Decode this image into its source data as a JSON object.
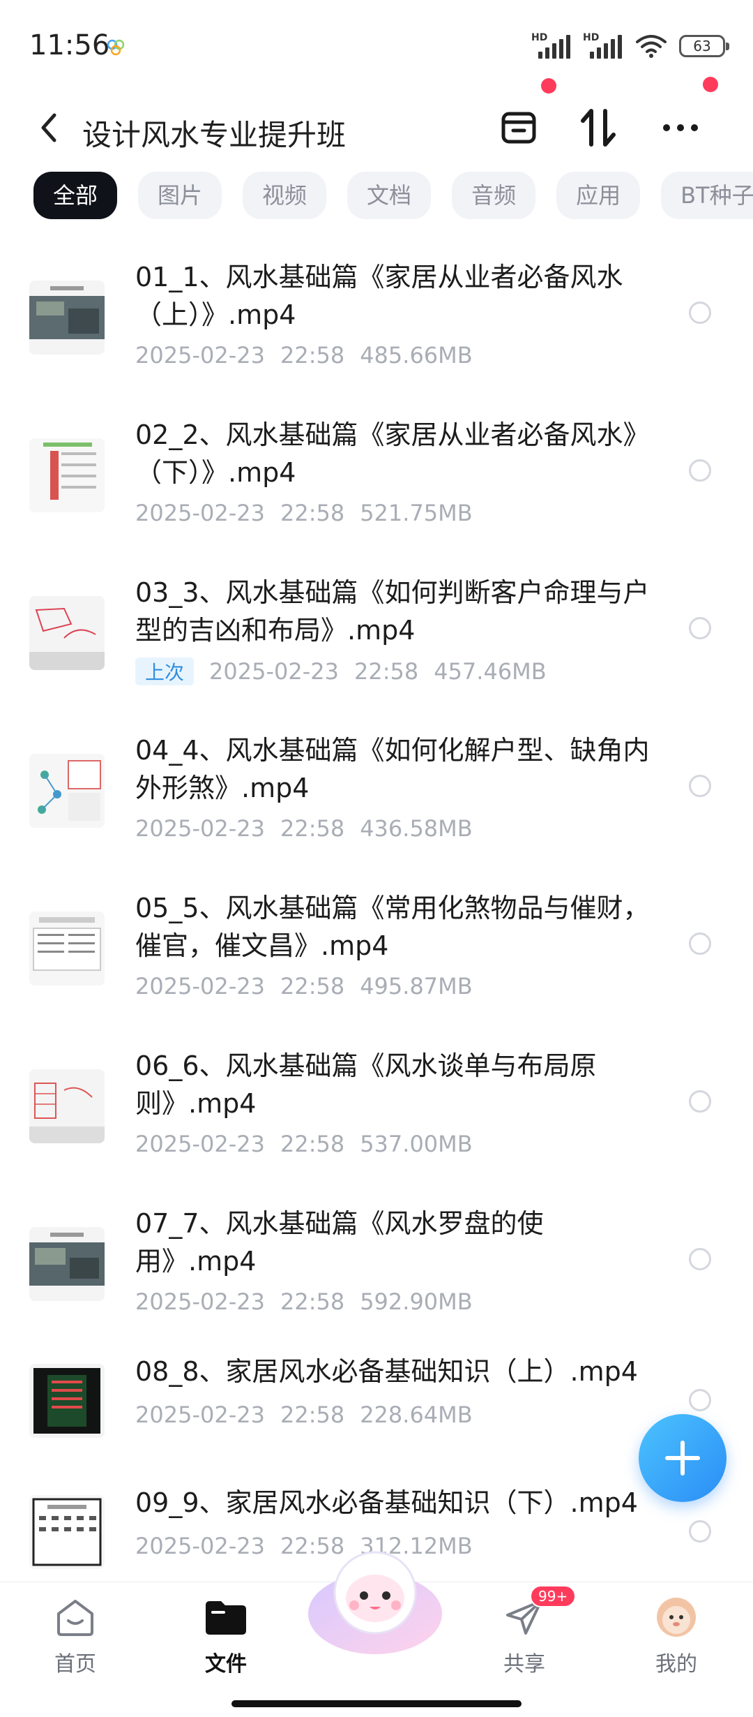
{
  "status": {
    "time": "11:56",
    "battery": "63",
    "hd_label": "HD"
  },
  "header": {
    "title": "设计风水专业提升班"
  },
  "tabs": [
    "全部",
    "图片",
    "视频",
    "文档",
    "音频",
    "应用",
    "BT种子"
  ],
  "files": [
    {
      "name": "01_1、风水基础篇《家居从业者必备风水（上）》.mp4",
      "date": "2025-02-23",
      "time": "22:58",
      "size": "485.66MB",
      "recent": ""
    },
    {
      "name": "02_2、风水基础篇《家居从业者必备风水》（下）》.mp4",
      "date": "2025-02-23",
      "time": "22:58",
      "size": "521.75MB",
      "recent": ""
    },
    {
      "name": "03_3、风水基础篇《如何判断客户命理与户型的吉凶和布局》.mp4",
      "date": "2025-02-23",
      "time": "22:58",
      "size": "457.46MB",
      "recent": "上次"
    },
    {
      "name": "04_4、风水基础篇《如何化解户型、缺角内外形煞》.mp4",
      "date": "2025-02-23",
      "time": "22:58",
      "size": "436.58MB",
      "recent": ""
    },
    {
      "name": "05_5、风水基础篇《常用化煞物品与催财，催官，催文昌》.mp4",
      "date": "2025-02-23",
      "time": "22:58",
      "size": "495.87MB",
      "recent": ""
    },
    {
      "name": "06_6、风水基础篇《风水谈单与布局原则》.mp4",
      "date": "2025-02-23",
      "time": "22:58",
      "size": "537.00MB",
      "recent": ""
    },
    {
      "name": "07_7、风水基础篇《风水罗盘的使用》.mp4",
      "date": "2025-02-23",
      "time": "22:58",
      "size": "592.90MB",
      "recent": ""
    },
    {
      "name": "08_8、家居风水必备基础知识（上）.mp4",
      "date": "2025-02-23",
      "time": "22:58",
      "size": "228.64MB",
      "recent": ""
    },
    {
      "name": "09_9、家居风水必备基础知识（下）.mp4",
      "date": "2025-02-23",
      "time": "22:58",
      "size": "312.12MB",
      "recent": ""
    }
  ],
  "nav": {
    "home": "首页",
    "files": "文件",
    "share": "共享",
    "share_badge": "99+",
    "mine": "我的"
  }
}
